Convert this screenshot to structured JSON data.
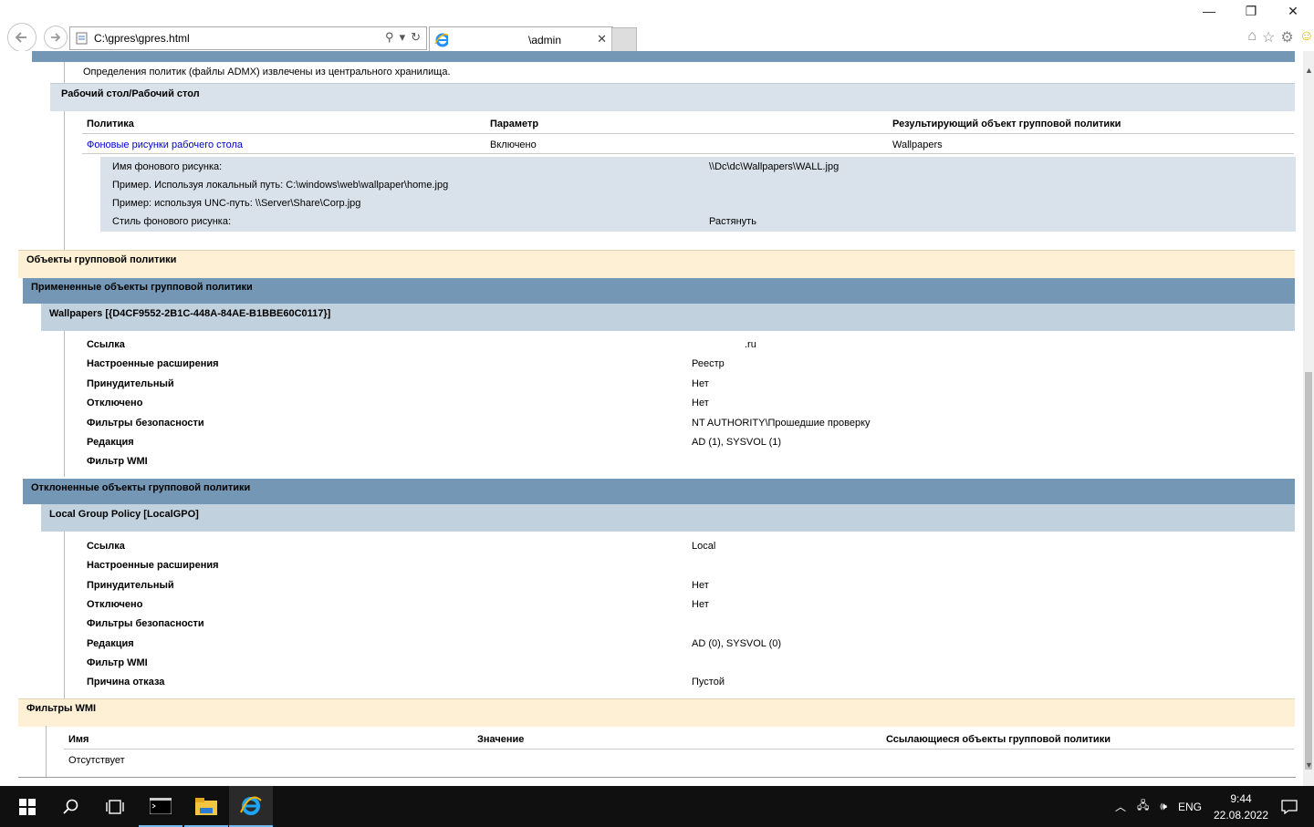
{
  "browser": {
    "address": "C:\\gpres\\gpres.html",
    "tab_title": "\\admin",
    "window_buttons": {
      "minimize": "—",
      "restore": "❐",
      "close": "✕"
    }
  },
  "content": {
    "admx_note": "Определения политик (файлы ADMX) извлечены из центрального хранилища.",
    "desktop_section": "Рабочий стол/Рабочий стол",
    "policy_table": {
      "headers": [
        "Политика",
        "Параметр",
        "Результирующий объект групповой политики"
      ],
      "row": {
        "policy": "Фоновые рисунки рабочего стола",
        "setting": "Включено",
        "gpo": "Wallpapers"
      },
      "details": [
        {
          "label": "Имя фонового рисунка:",
          "value": "\\\\Dc\\dc\\Wallpapers\\WALL.jpg"
        },
        {
          "label": "Пример. Используя локальный путь: C:\\windows\\web\\wallpaper\\home.jpg",
          "value": ""
        },
        {
          "label": "Пример: используя UNC-путь: \\\\Server\\Share\\Corp.jpg",
          "value": ""
        },
        {
          "label": "Стиль фонового рисунка:",
          "value": "Растянуть"
        }
      ]
    },
    "gpo_section": "Объекты групповой политики",
    "applied_section": "Примененные объекты групповой политики",
    "applied_gpo": {
      "name": "Wallpapers [{D4CF9552-2B1C-448A-84AE-B1BBE60C0117}]",
      "rows": [
        {
          "label": "Ссылка",
          "value": ".ru"
        },
        {
          "label": "Настроенные расширения",
          "value": "Реестр"
        },
        {
          "label": "Принудительный",
          "value": "Нет"
        },
        {
          "label": "Отключено",
          "value": "Нет"
        },
        {
          "label": "Фильтры безопасности",
          "value": "NT AUTHORITY\\Прошедшие проверку"
        },
        {
          "label": "Редакция",
          "value": "AD (1), SYSVOL (1)"
        },
        {
          "label": "Фильтр WMI",
          "value": ""
        }
      ]
    },
    "denied_section": "Отклоненные объекты групповой политики",
    "denied_gpo": {
      "name": "Local Group Policy [LocalGPO]",
      "rows": [
        {
          "label": "Ссылка",
          "value": "Local"
        },
        {
          "label": "Настроенные расширения",
          "value": ""
        },
        {
          "label": "Принудительный",
          "value": "Нет"
        },
        {
          "label": "Отключено",
          "value": "Нет"
        },
        {
          "label": "Фильтры безопасности",
          "value": ""
        },
        {
          "label": "Редакция",
          "value": "AD (0), SYSVOL (0)"
        },
        {
          "label": "Фильтр WMI",
          "value": ""
        },
        {
          "label": "Причина отказа",
          "value": "Пустой"
        }
      ]
    },
    "wmi_section": "Фильтры WMI",
    "wmi_table": {
      "headers": [
        "Имя",
        "Значение",
        "Ссылающиеся объекты групповой политики"
      ],
      "empty": "Отсутствует"
    }
  },
  "taskbar": {
    "lang": "ENG",
    "time": "9:44",
    "date": "22.08.2022"
  },
  "colors": {
    "blue_header": "#7397b5",
    "light_blue_header": "#c1d1de",
    "pale_box": "#d9e2ea",
    "cream_header": "#fdf0d4",
    "link": "#0000cc"
  }
}
